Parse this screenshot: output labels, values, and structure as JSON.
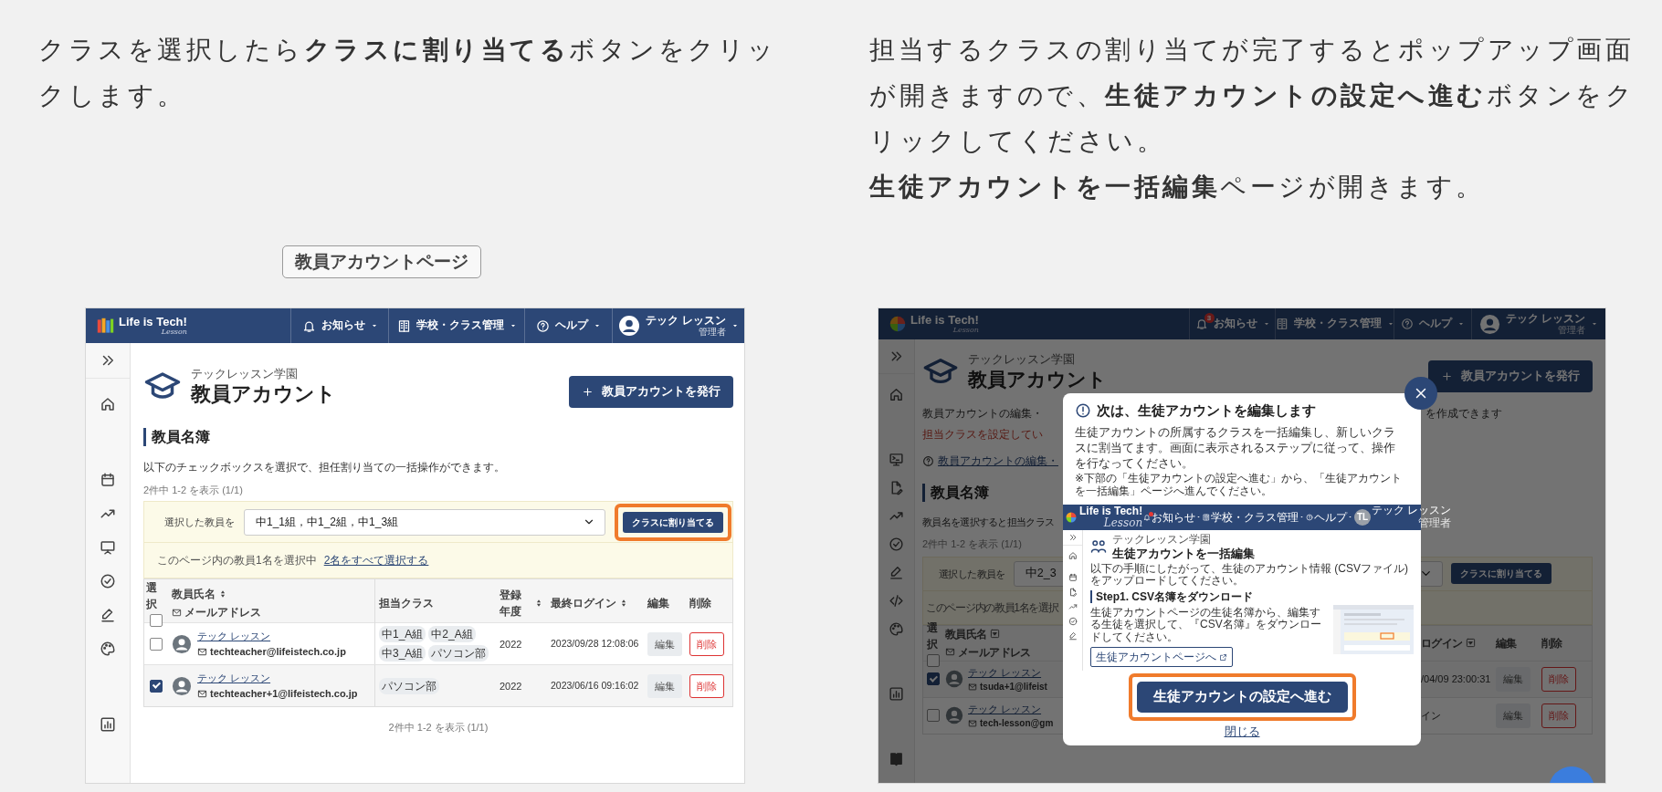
{
  "instructions": {
    "left": [
      "クラスを選択したら**クラスに割り当てる**ボタンをクリックします。"
    ],
    "right": [
      "担当するクラスの割り当てが完了するとポップアップ画面が開きますので、**生徒アカウントの設定へ進む**ボタンをクリックしてください。",
      "**生徒アカウントを一括編集**ページが開きます。"
    ]
  },
  "page_label": "教員アカウントページ",
  "teacher_page": {
    "navbar": {
      "logo": "Life is Tech!",
      "logo_sub": "Lesson",
      "menus": [
        "お知らせ",
        "学校・クラス管理",
        "ヘルプ"
      ],
      "user_name": "テック レッスン",
      "user_role": "管理者"
    },
    "school": "テックレッスン学園",
    "title": "教員アカウント",
    "issue_button": "教員アカウントを発行",
    "section": "教員名簿",
    "description": "以下のチェックボックスを選択で、担任割り当ての一括操作ができます。",
    "count_top": "2件中 1-2 を表示 (1/1)",
    "bulk": {
      "label": "選択した教員を",
      "value": "中1_1組，中1_2組，中1_3組",
      "button": "クラスに割り当てる",
      "highlighted": true
    },
    "notice": "このページ内の教員1名を選択中",
    "select_all_link": "2名をすべて選択する",
    "columns": {
      "select": "選択",
      "name": "教員氏名",
      "email": "メールアドレス",
      "classes": "担当クラス",
      "year": "登録年度",
      "login": "最終ログイン",
      "edit": "編集",
      "delete": "削除"
    },
    "select_all_checked": false,
    "rows": [
      {
        "name": "テック レッスン",
        "email": "techteacher@lifeistech.co.jp",
        "classes": [
          "中1_A組",
          "中2_A組",
          "中3_A組",
          "パソコン部"
        ],
        "year": "2022",
        "last_login": "2023/09/28 12:08:06",
        "edit": "編集",
        "delete": "削除",
        "checked": false
      },
      {
        "name": "テック レッスン",
        "email": "techteacher+1@lifeistech.co.jp",
        "classes": [
          "パソコン部"
        ],
        "year": "2022",
        "last_login": "2023/06/16 09:16:02",
        "edit": "編集",
        "delete": "削除",
        "checked": true
      }
    ],
    "count_bottom": "2件中 1-2 を表示 (1/1)"
  },
  "popup_page": {
    "navbar": {
      "logo": "Life is Tech!",
      "logo_sub": "Lesson",
      "notification_count": "3",
      "menus": [
        "お知らせ",
        "学校・クラス管理",
        "ヘルプ"
      ],
      "user_name": "テック レッスン",
      "user_role": "管理者"
    },
    "school": "テックレッスン学園",
    "title": "教員アカウント",
    "issue_button": "教員アカウントを発行",
    "intro_left": "教員アカウントの編集・",
    "intro_right": "を作成できます",
    "warning": "担当クラスを設定してい",
    "help_link": "教員アカウントの編集・",
    "section": "教員名簿",
    "description": "教員名を選択すると担当クラス",
    "count": "2件中 1-2 を表示 (1/1)",
    "bulk": {
      "label": "選択した教員を",
      "value": "中2_3",
      "button": "クラスに割り当てる"
    },
    "notice": "このページ内の教員1名を選択",
    "columns": {
      "select": "選択",
      "name": "教員氏名",
      "email": "メールアドレス",
      "login": "ログイン",
      "edit": "編集",
      "delete": "削除"
    },
    "select_all_checked": false,
    "rows": [
      {
        "name": "テック レッスン",
        "email": "tsuda+1@lifeist",
        "login": "/04/09 23:00:31",
        "edit": "編集",
        "delete": "削除",
        "checked": true
      },
      {
        "name": "テック レッスン",
        "email": "tech-lesson@gm",
        "login": "イン",
        "edit": "編集",
        "delete": "削除",
        "checked": false
      }
    ],
    "modal": {
      "title": "次は、生徒アカウントを編集します",
      "body": "生徒アカウントの所属するクラスを一括編集し、新しいクラスに割当てます。画面に表示されるステップに従って、操作を行なってください。",
      "note": "※下部の「生徒アカウントの設定へ進む」から、「生徒アカウントを一括編集」ページへ進んでください。",
      "preview": {
        "navbar": {
          "logo": "Life is Tech!",
          "logo_sub": "Lesson",
          "notification_dot": true,
          "menus": [
            "お知らせ",
            "学校・クラス管理",
            "ヘルプ"
          ],
          "initials": "TL",
          "user_name": "テック レッスン",
          "user_role": "管理者"
        },
        "school": "テックレッスン学園",
        "title": "生徒アカウントを一括編集",
        "description": "以下の手順にしたがって、生徒のアカウント情報 (CSVファイル) をアップロードしてください。",
        "step_title": "Step1. CSV名簿をダウンロード",
        "step_text": "生徒アカウントページの生徒名簿から、編集する生徒を選択して、『CSV名簿』をダウンロードしてください。",
        "step_button": "生徒アカウントページへ"
      },
      "primary_button": "生徒アカウントの設定へ進む",
      "primary_highlighted": true,
      "close_link": "閉じる"
    }
  }
}
